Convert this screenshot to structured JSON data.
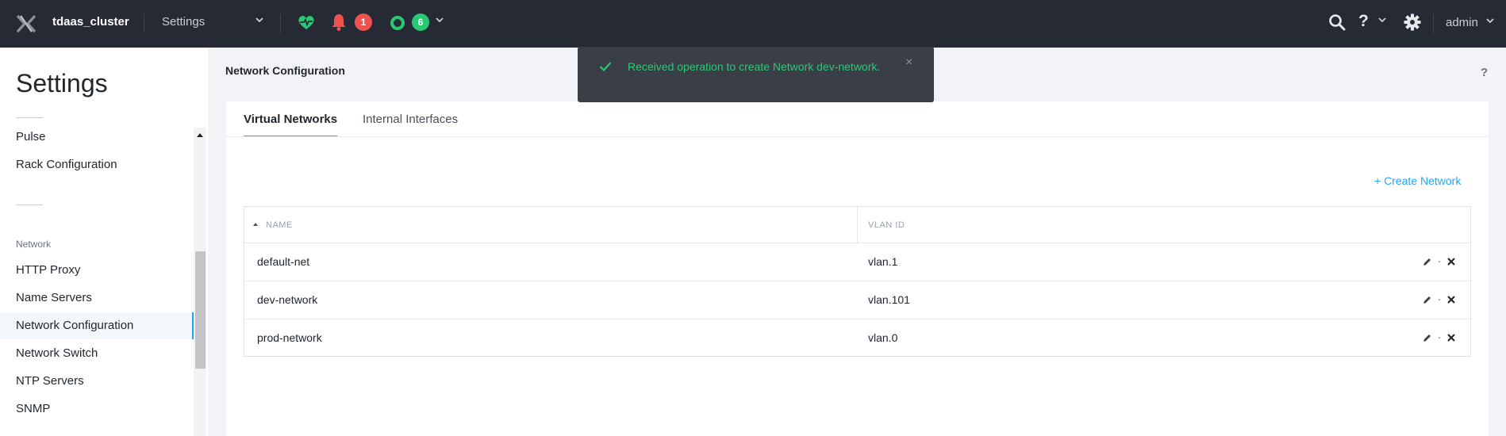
{
  "topbar": {
    "cluster_name": "tdaas_cluster",
    "current_page": "Settings",
    "alerts_count": "1",
    "tasks_count": "6",
    "help_label": "?",
    "user_name": "admin"
  },
  "sidebar": {
    "title": "Settings",
    "items_top": [
      {
        "label": "Pulse"
      },
      {
        "label": "Rack Configuration"
      }
    ],
    "group_label": "Network",
    "items_network": [
      {
        "label": "HTTP Proxy",
        "active": false
      },
      {
        "label": "Name Servers",
        "active": false
      },
      {
        "label": "Network Configuration",
        "active": true
      },
      {
        "label": "Network Switch",
        "active": false
      },
      {
        "label": "NTP Servers",
        "active": false
      },
      {
        "label": "SNMP",
        "active": false
      }
    ]
  },
  "main": {
    "heading": "Network Configuration",
    "help_label": "?",
    "tabs": [
      {
        "label": "Virtual Networks",
        "active": true
      },
      {
        "label": "Internal Interfaces",
        "active": false
      }
    ],
    "create_link": "+ Create Network",
    "table": {
      "columns": [
        "NAME",
        "VLAN ID"
      ],
      "sort_column": "NAME",
      "sort_direction": "ascending",
      "rows": [
        {
          "name": "default-net",
          "vlan": "vlan.1"
        },
        {
          "name": "dev-network",
          "vlan": "vlan.101"
        },
        {
          "name": "prod-network",
          "vlan": "vlan.0"
        }
      ]
    }
  },
  "toast": {
    "message": "Received operation to create Network dev-network.",
    "close_label": "×",
    "status_color": "#2bc873"
  },
  "colors": {
    "accent": "#22a5f7",
    "topbar_bg": "#262a35",
    "alert_red": "#ef5350",
    "success_green": "#2bc873"
  }
}
